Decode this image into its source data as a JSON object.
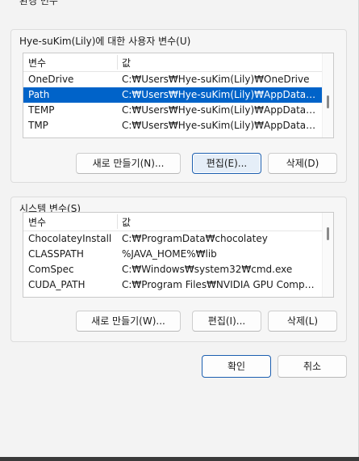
{
  "window": {
    "title": "환경 변수"
  },
  "user_vars": {
    "label": "Hye-suKim(Lily)에 대한 사용자 변수(U)",
    "columns": {
      "name": "변수",
      "value": "값"
    },
    "rows": [
      {
        "name": "OneDrive",
        "value": "C:₩Users₩Hye-suKim(Lily)₩OneDrive"
      },
      {
        "name": "Path",
        "value": "C:₩Users₩Hye-suKim(Lily)₩AppData₩Local..."
      },
      {
        "name": "TEMP",
        "value": "C:₩Users₩Hye-suKim(Lily)₩AppData₩Local..."
      },
      {
        "name": "TMP",
        "value": "C:₩Users₩Hye-suKim(Lily)₩AppData₩Local..."
      }
    ],
    "selected_row": "Path",
    "buttons": {
      "new": "새로 만들기(N)...",
      "edit": "편집(E)...",
      "delete": "삭제(D)"
    }
  },
  "system_vars": {
    "label": "시스템 변수(S)",
    "columns": {
      "name": "변수",
      "value": "값"
    },
    "rows": [
      {
        "name": "ChocolateyInstall",
        "value": "C:₩ProgramData₩chocolatey"
      },
      {
        "name": "CLASSPATH",
        "value": "%JAVA_HOME%₩lib"
      },
      {
        "name": "ComSpec",
        "value": "C:₩Windows₩system32₩cmd.exe"
      },
      {
        "name": "CUDA_PATH",
        "value": "C:₩Program Files₩NVIDIA GPU Computing..."
      }
    ],
    "buttons": {
      "new": "새로 만들기(W)...",
      "edit": "편집(I)...",
      "delete": "삭제(L)"
    }
  },
  "footer": {
    "ok": "확인",
    "cancel": "취소"
  },
  "colors": {
    "selection": "#0063c9",
    "focus_border": "#1c5fb0"
  }
}
